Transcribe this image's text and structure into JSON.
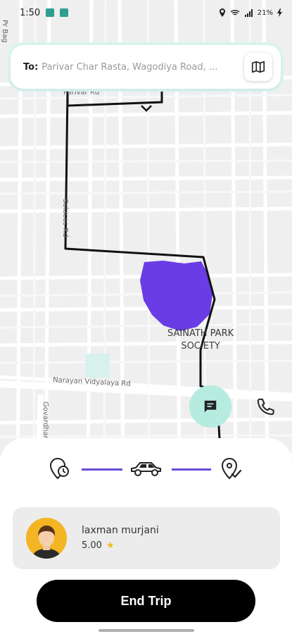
{
  "status_bar": {
    "time": "1:50",
    "battery": "21%",
    "icons": [
      "app-icon-1",
      "app-icon-2",
      "location-icon",
      "wifi-call-icon",
      "signal-icon",
      "battery-icon",
      "charging-icon"
    ]
  },
  "destination": {
    "label": "To:",
    "value": "Parivar Char Rasta, Wagodiya Road, ...",
    "map_button_icon": "map-icon"
  },
  "map": {
    "labels": {
      "pr_bag": "Pr Bag",
      "parivar_rd": "Parivar Rd",
      "solaces_rd": "Solaces Rd",
      "narayan_vidyalaya_rd": "Narayan Vidyalaya Rd",
      "govardhan": "Govardhan"
    },
    "poi": {
      "line1": "SAINATH PARK",
      "line2": "SOCIETY"
    },
    "route_color": "#111111",
    "area_color": "#6a3ce6"
  },
  "trip_progress": {
    "start_icon": "location-clock-icon",
    "vehicle_icon": "car-icon",
    "end_icon": "location-check-icon",
    "line_color": "#6a4bd8"
  },
  "actions": {
    "chat_icon": "chat-icon",
    "call_icon": "phone-icon"
  },
  "driver": {
    "name": "laxman murjani",
    "rating": "5.00",
    "star_color": "#f4b524"
  },
  "end_trip_label": "End Trip"
}
